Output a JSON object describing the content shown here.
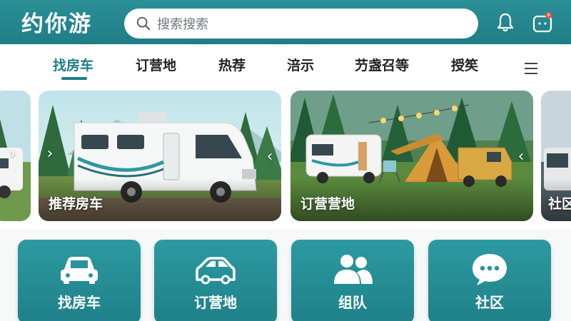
{
  "header": {
    "logo": "约你游",
    "search_placeholder": "搜索搜索",
    "notification_badge": "8"
  },
  "tabs": [
    {
      "label": "找房车",
      "active": true
    },
    {
      "label": "订营地",
      "active": false
    },
    {
      "label": "热荐",
      "active": false
    },
    {
      "label": "涪示",
      "active": false
    },
    {
      "label": "芀盏召等",
      "active": false
    },
    {
      "label": "授笶",
      "active": false
    }
  ],
  "carousel": {
    "cards": [
      {
        "label": ""
      },
      {
        "label": "推荐房车"
      },
      {
        "label": "订营营地"
      },
      {
        "label": "社区"
      }
    ]
  },
  "tiles": [
    {
      "label": "找房车",
      "icon": "car-icon"
    },
    {
      "label": "订营地",
      "icon": "car-icon"
    },
    {
      "label": "组队",
      "icon": "group-icon"
    },
    {
      "label": "社区",
      "icon": "chat-bubble-icon"
    }
  ],
  "colors": {
    "brand": "#1f7d86",
    "tile": "#2c9aa1",
    "badge": "#e8533f"
  }
}
